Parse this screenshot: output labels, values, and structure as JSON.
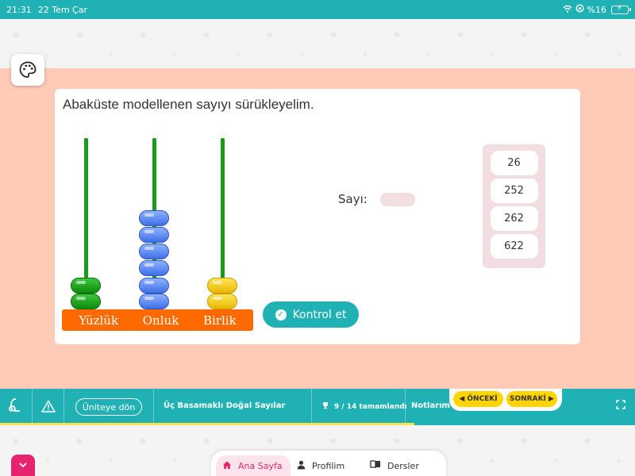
{
  "status_bar": {
    "time": "21:31",
    "date": "22 Tem Çar",
    "battery": "%16"
  },
  "question": {
    "text": "Abaküste modellenen sayıyı sürükleyelim."
  },
  "abacus": {
    "labels": [
      "Yüzlük",
      "Onluk",
      "Birlik"
    ],
    "bead_counts": [
      2,
      6,
      2
    ]
  },
  "answer": {
    "label": "Sayı:",
    "value": ""
  },
  "check_button": {
    "label": "Kontrol et"
  },
  "options": [
    "26",
    "252",
    "262",
    "622"
  ],
  "lesson_bar": {
    "unit_button": "Üniteye dön",
    "lesson_title": "Üç Basamaklı Doğal Sayılar",
    "progress": "9 / 14 tamamlandı",
    "progress_fraction": 0.643,
    "notes": "Notlarım",
    "prev": "ÖNCEKİ",
    "next": "SONRAKİ"
  },
  "bottom_nav": {
    "home": "Ana Sayfa",
    "profile": "Profilim",
    "lessons": "Dersler"
  },
  "colors": {
    "teal": "#20b1b5",
    "salmon": "#ffcab6",
    "orange": "#ff6a00",
    "pink": "#e6236e",
    "yellow": "#ffd400"
  }
}
